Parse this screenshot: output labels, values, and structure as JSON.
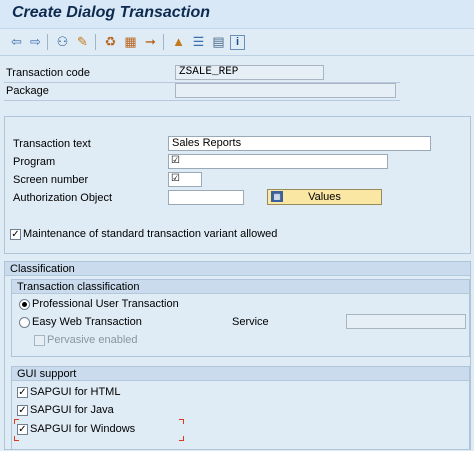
{
  "window": {
    "title": "Create Dialog Transaction"
  },
  "toolbar": {
    "icons": [
      "back-arrow-icon",
      "forward-arrow-icon",
      "glasses-display-icon",
      "other-object-icon",
      "where-used-icon",
      "hierarchy-icon",
      "navigate-icon",
      "tree-icon",
      "list-icon",
      "info-icon"
    ]
  },
  "header": {
    "transaction_code_label": "Transaction code",
    "transaction_code_value": "ZSALE_REP",
    "package_label": "Package",
    "package_value": ""
  },
  "details": {
    "transaction_text_label": "Transaction text",
    "transaction_text_value": "Sales Reports",
    "program_label": "Program",
    "program_value": "",
    "screen_number_label": "Screen number",
    "screen_number_value": "",
    "authorization_object_label": "Authorization Object",
    "authorization_object_value": "",
    "values_button_label": "Values",
    "maintenance_label": "Maintenance of standard transaction variant allowed",
    "maintenance_checked": true
  },
  "classification": {
    "title": "Classification",
    "transaction_classification_title": "Transaction classification",
    "professional_label": "Professional User Transaction",
    "easy_web_label": "Easy Web Transaction",
    "service_label": "Service",
    "service_value": "",
    "pervasive_label": "Pervasive enabled"
  },
  "gui_support": {
    "title": "GUI support",
    "html_label": "SAPGUI for HTML",
    "java_label": "SAPGUI for Java",
    "windows_label": "SAPGUI for Windows"
  },
  "colors": {
    "background": "#dfebf5",
    "title_text": "#0d2a4f",
    "values_button": "#fbe7a4",
    "focus_marker": "#d83a1a"
  }
}
